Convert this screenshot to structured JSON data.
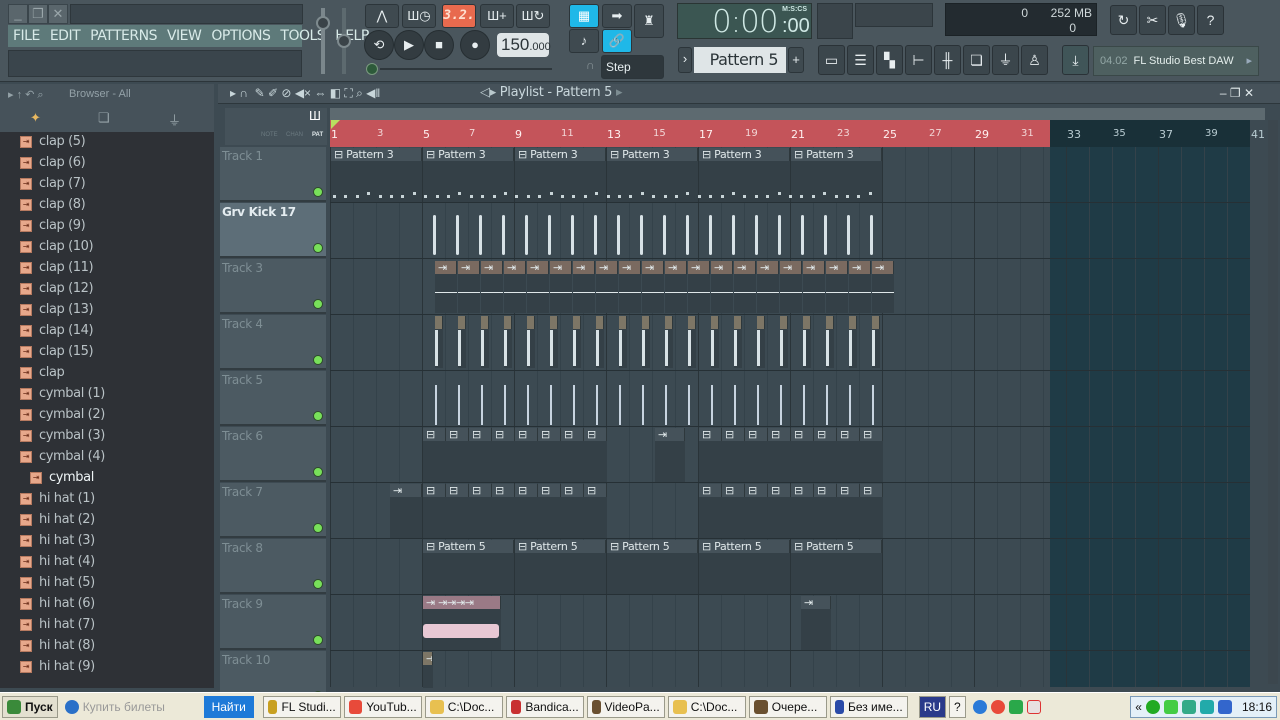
{
  "menu": [
    "FILE",
    "EDIT",
    "PATTERNS",
    "VIEW",
    "OPTIONS",
    "TOOLS",
    "HELP"
  ],
  "transport": {
    "step_display": "3.2.",
    "tempo_int": "150",
    "tempo_frac": ".000",
    "snap": "Step"
  },
  "time": {
    "value": "0:00",
    "cs": ":00",
    "label": "M:S:CS"
  },
  "pattern": {
    "selected": "Pattern 5",
    "add": "+"
  },
  "memory": {
    "cpu": "0",
    "ram": "252 MB",
    "poly": "0"
  },
  "hint": {
    "num": "04.02",
    "text": "FL Studio Best DAW"
  },
  "browser": {
    "title": "Browser - All",
    "items": [
      "clap (5)",
      "clap (6)",
      "clap (7)",
      "clap (8)",
      "clap (9)",
      "clap (10)",
      "clap (11)",
      "clap (12)",
      "clap (13)",
      "clap (14)",
      "clap (15)",
      "clap",
      "cymbal (1)",
      "cymbal (2)",
      "cymbal (3)",
      "cymbal (4)",
      "cymbal",
      "hi hat (1)",
      "hi hat (2)",
      "hi hat (3)",
      "hi hat (4)",
      "hi hat (5)",
      "hi hat (6)",
      "hi hat (7)",
      "hi hat (8)",
      "hi hat (9)"
    ],
    "selected_index": 16
  },
  "playlist": {
    "title": "Playlist - Pattern 5",
    "mode_labels": [
      "NOTE",
      "CHAN",
      "PAT"
    ],
    "ruler": [
      "1",
      "3",
      "5",
      "7",
      "9",
      "11",
      "13",
      "15",
      "17",
      "19",
      "21",
      "23",
      "25",
      "27",
      "29",
      "31",
      "33",
      "35",
      "37",
      "39",
      "41"
    ],
    "tracks": [
      "Track 1",
      "Grv Kick 17",
      "Track 3",
      "Track 4",
      "Track 5",
      "Track 6",
      "Track 7",
      "Track 8",
      "Track 9",
      "Track 10"
    ],
    "active_track": 1,
    "track1_clips": [
      "Pattern 3",
      "Pattern 3",
      "Pattern 3",
      "Pattern 3",
      "Pattern 3",
      "Pattern 3"
    ],
    "track8_clips": [
      "Pattern 5",
      "Pattern 5",
      "Pattern 5",
      "Pattern 5",
      "Pattern 5"
    ]
  },
  "taskbar": {
    "start": "Пуск",
    "search_placeholder": "Купить билеты",
    "search_btn": "Найти",
    "apps": [
      "FL Studi...",
      "YouTub...",
      "C:\\Doc...",
      "Bandica...",
      "VideoPa...",
      "C:\\Doc...",
      "Очере...",
      "Без име..."
    ],
    "lang": "RU",
    "clock": "18:16"
  }
}
